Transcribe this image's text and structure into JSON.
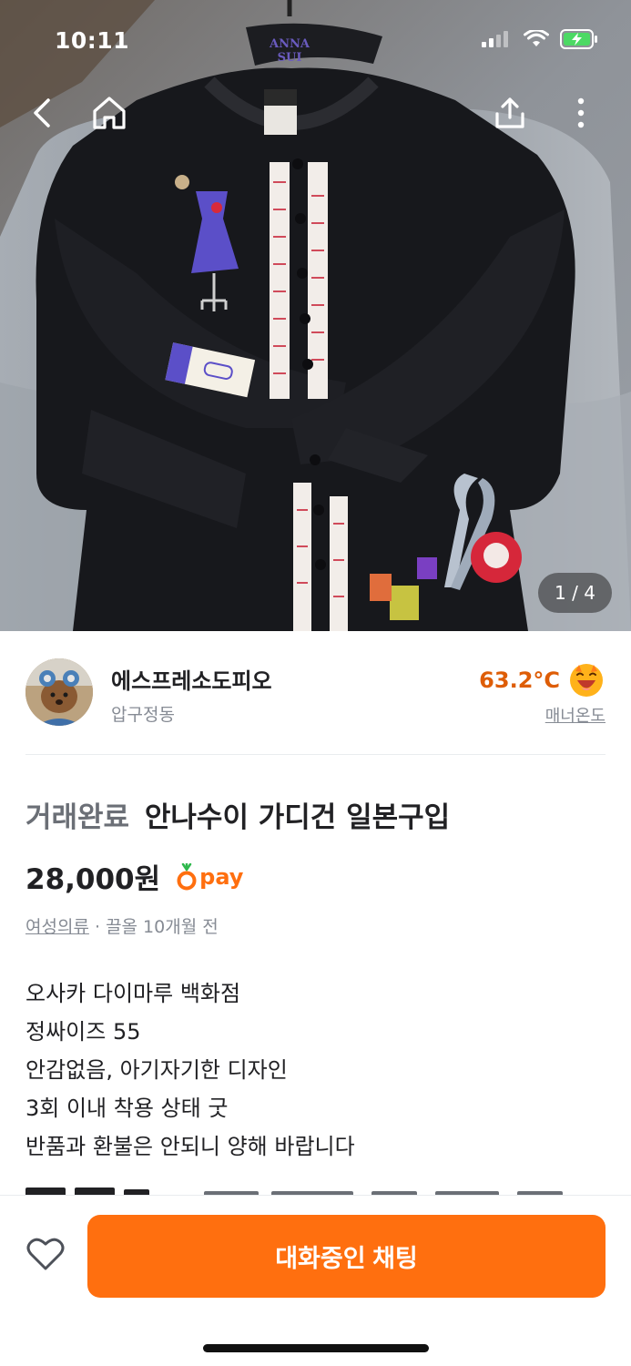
{
  "status_bar": {
    "time": "10:11"
  },
  "hero": {
    "photo_counter": "1 / 4",
    "tag_text_line1": "ANNA",
    "tag_text_line2": "SUI"
  },
  "nav": {
    "back_icon": "chevron-left-icon",
    "home_icon": "home-icon",
    "share_icon": "share-icon",
    "more_icon": "more-vertical-icon"
  },
  "seller": {
    "name": "에스프레소도피오",
    "region": "압구정동",
    "manner_temperature": "63.2°C",
    "manner_label": "매너온도",
    "temperature_color": "#de5d06"
  },
  "article": {
    "status": "거래완료",
    "title": "안나수이 가디건 일본구입",
    "price": "28,000원",
    "pay_label": "pay",
    "category": "여성의류",
    "separator": "·",
    "time": "끌올 10개월 전",
    "description": [
      "오사카 다이마루 백화점",
      "정싸이즈 55",
      "안감없음, 아기자기한 디자인",
      "3회 이내 착용 상태 굿",
      "반품과 환불은 안되니 양해 바랍니다"
    ]
  },
  "bottom_bar": {
    "like_icon": "heart-outline-icon",
    "chat_button_label": "대화중인 채팅"
  },
  "colors": {
    "accent": "#ff6f0f",
    "text_primary": "#212124",
    "text_secondary": "#868b94"
  }
}
